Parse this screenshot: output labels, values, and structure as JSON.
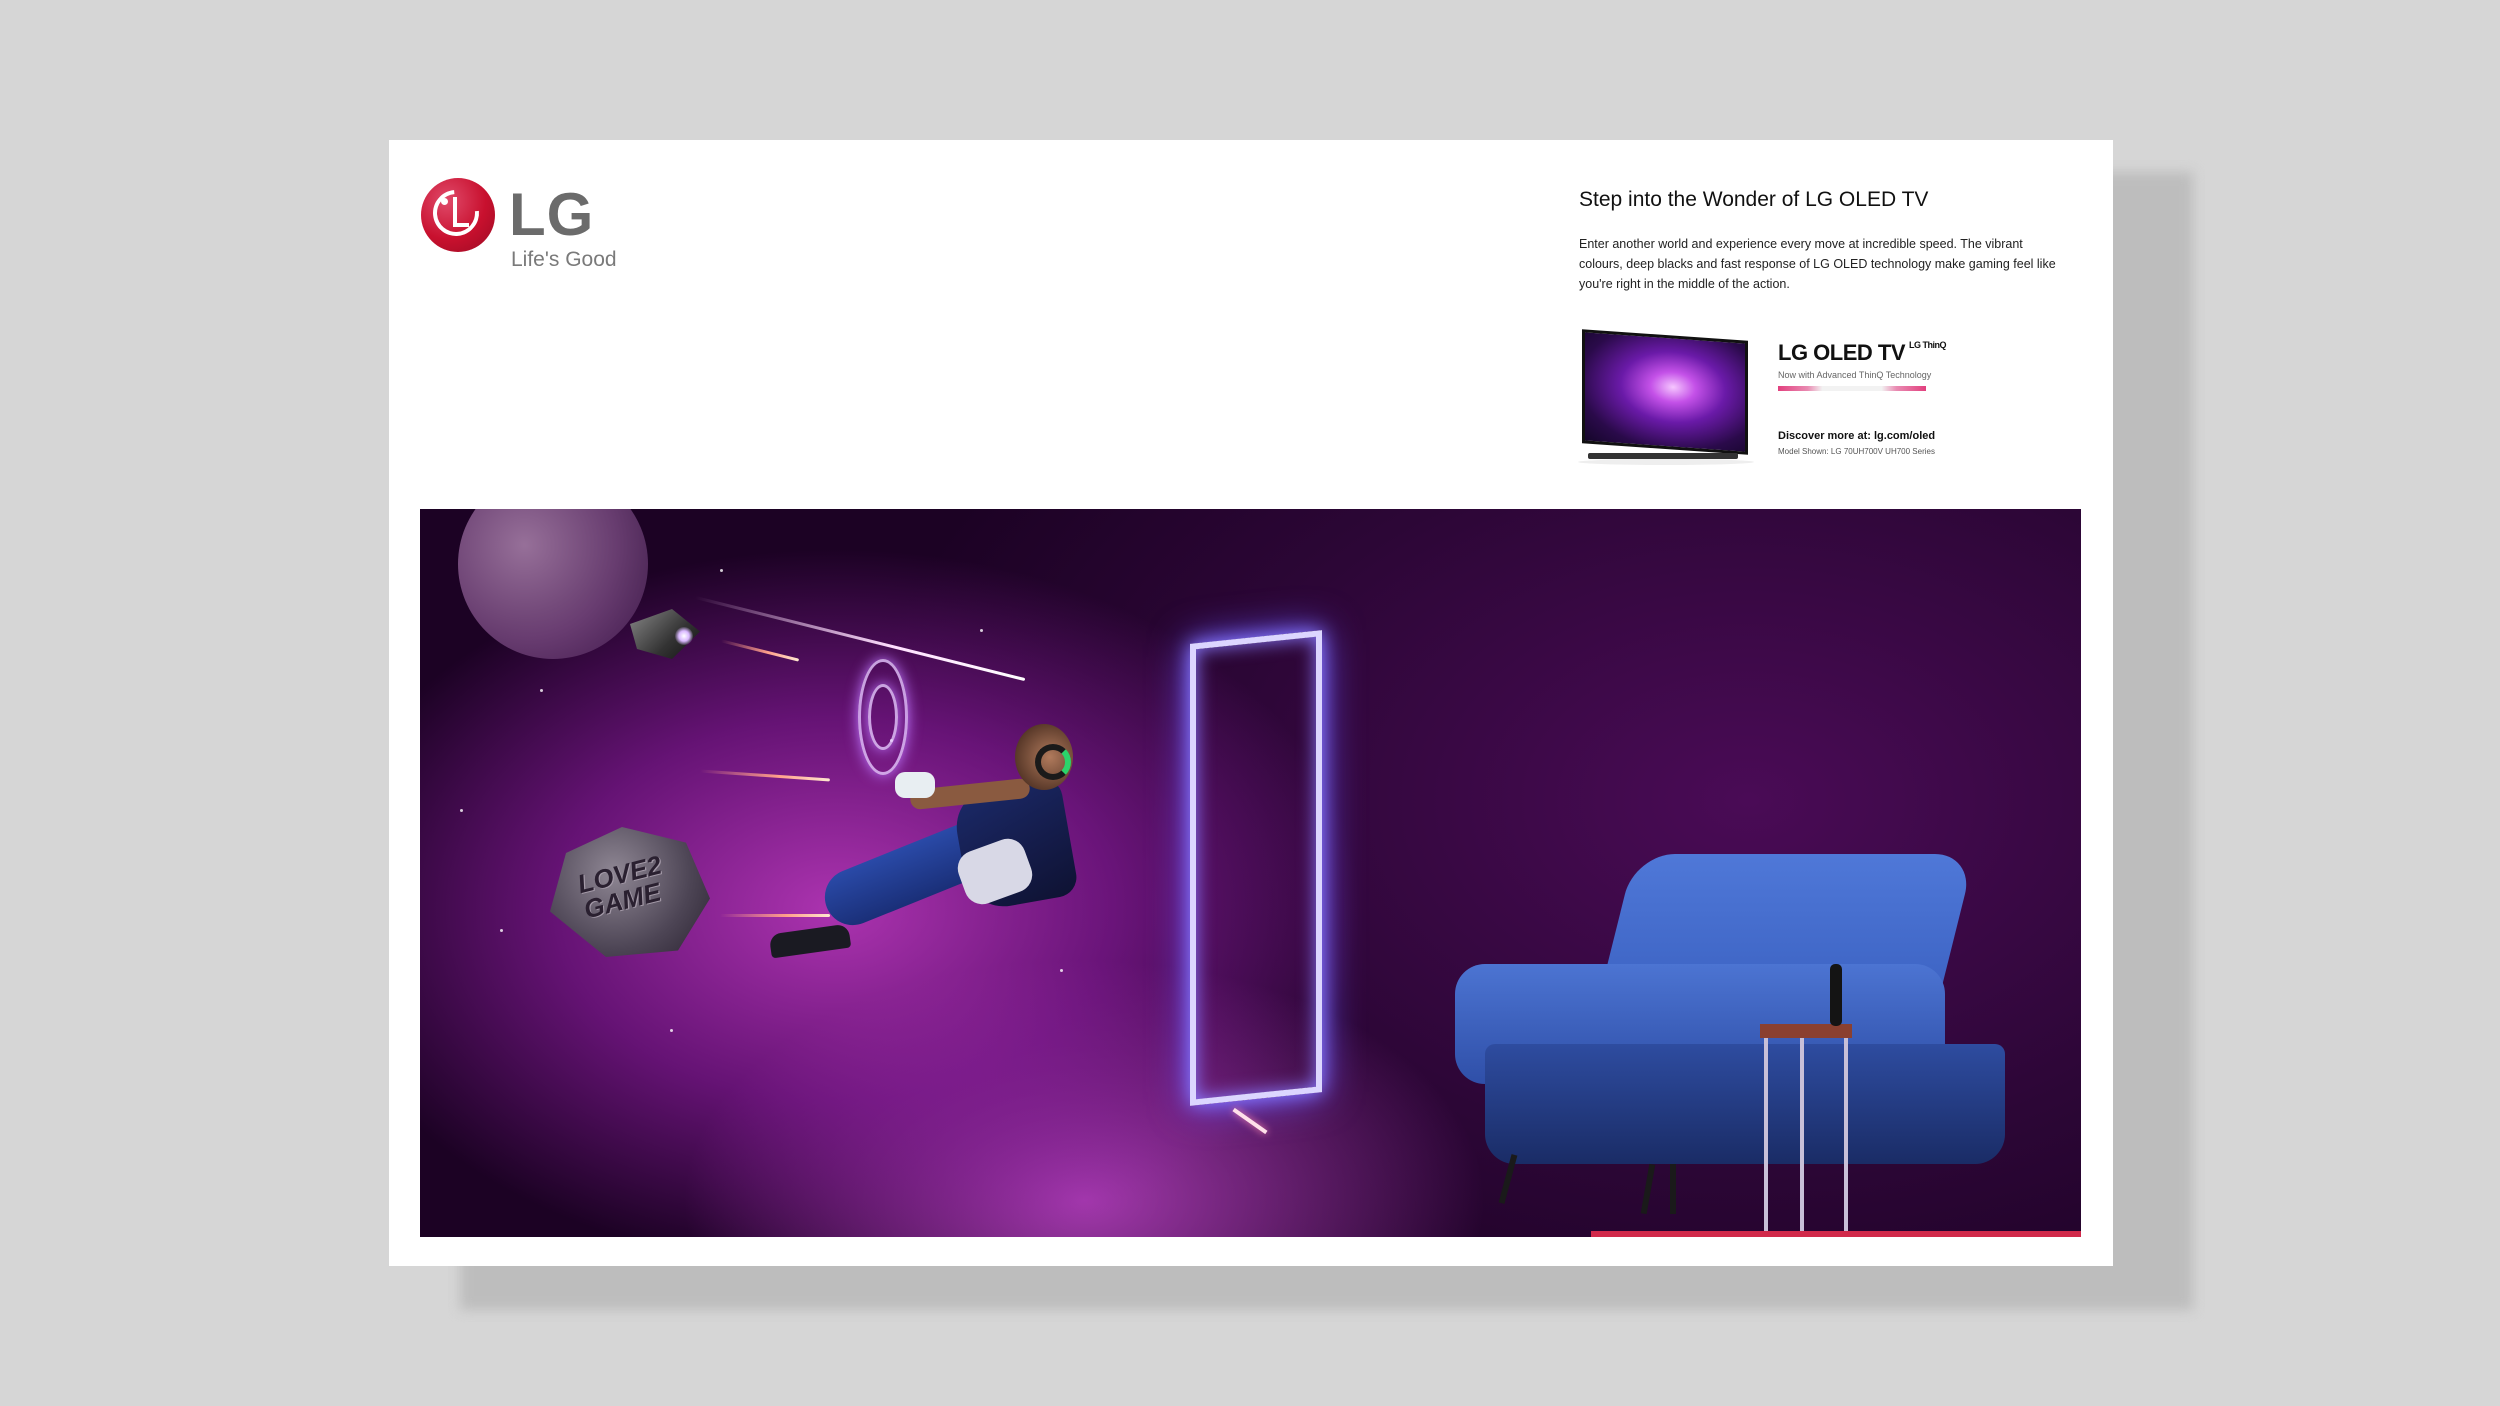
{
  "logo": {
    "name": "LG",
    "tagline": "Life's Good"
  },
  "headline": "Step into the Wonder of LG OLED TV",
  "body": "Enter another world and experience every move at incredible speed. The vibrant colours, deep blacks and fast response of LG OLED technology make gaming feel like you're right in the middle of the action.",
  "product": {
    "title": "LG OLED TV",
    "thinq": "LG ThinQ",
    "subtitle": "Now with Advanced ThinQ Technology",
    "discover": "Discover more at: lg.com/oled",
    "model": "Model Shown: LG 70UH700V UH700 Series"
  },
  "hero": {
    "asteroid_text_1": "LOVE2",
    "asteroid_text_2": "GAME"
  },
  "colors": {
    "brand_red": "#c8102e",
    "accent_bar": "#d1294a",
    "sofa_blue": "#3a60c0",
    "portal_glow": "#8b7bff"
  }
}
